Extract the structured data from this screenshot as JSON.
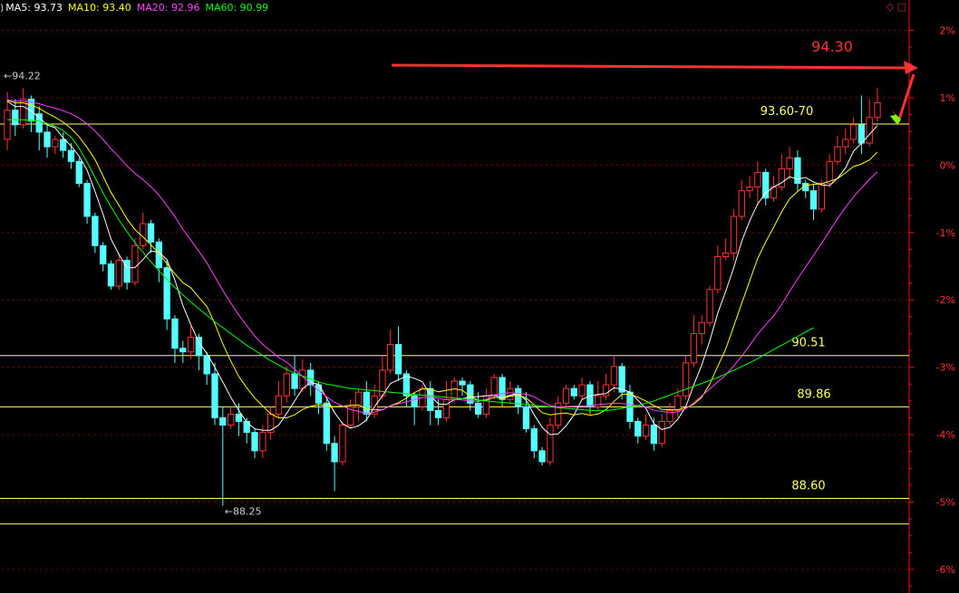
{
  "chart_data": {
    "type": "candlestick",
    "legend": {
      "prefix": ")",
      "items": [
        {
          "label": "MA5: 93.73",
          "color": "#ffffff"
        },
        {
          "label": "MA10: 93.40",
          "color": "#ffff00"
        },
        {
          "label": "MA20: 92.96",
          "color": "#ff40ff"
        },
        {
          "label": "MA60: 90.99",
          "color": "#00ff00"
        }
      ]
    },
    "corner_icons": "◇ □",
    "y_axis": {
      "side": "right",
      "unit": "percent",
      "ticks": [
        2,
        1,
        0,
        -1,
        -2,
        -3,
        -4,
        -5,
        -6
      ],
      "tick_labels": [
        "2%",
        "1%",
        "0%",
        "-1%",
        "-2%",
        "-3%",
        "-4%",
        "-5%",
        "-6%"
      ],
      "reference_price": 92.0,
      "range": [
        -6.35,
        2.45
      ],
      "grid": "dotted-red"
    },
    "colors": {
      "up": "#ff3232",
      "down": "#54ffff",
      "axis": "#ff0000",
      "ma5": "#ffffff",
      "ma10": "#ffff00",
      "ma20": "#ff40ff",
      "ma60": "#00ff00",
      "hline": "#ffff60",
      "annotation_red": "#ff3232"
    },
    "horizontal_levels": [
      {
        "price": 92.56,
        "label": "93.60-70"
      },
      {
        "price": 89.4,
        "label": "90.51"
      },
      {
        "price": 88.7,
        "label": "89.86"
      },
      {
        "price": 87.45,
        "label": "88.60"
      },
      {
        "price": 87.1,
        "label": ""
      }
    ],
    "annotations": {
      "target_label": "94.30",
      "high_label": "94.22",
      "low_label": "88.25"
    },
    "candles": [
      [
        92.35,
        92.75,
        93.0,
        92.2
      ],
      [
        92.75,
        92.55,
        92.9,
        92.4
      ],
      [
        92.55,
        92.9,
        93.05,
        92.5
      ],
      [
        92.9,
        92.6,
        92.95,
        92.45
      ],
      [
        92.7,
        92.45,
        92.8,
        92.2
      ],
      [
        92.45,
        92.25,
        92.55,
        92.1
      ],
      [
        92.25,
        92.35,
        92.4,
        92.15
      ],
      [
        92.35,
        92.2,
        92.45,
        92.1
      ],
      [
        92.2,
        92.05,
        92.3,
        91.95
      ],
      [
        92.05,
        91.75,
        92.1,
        91.7
      ],
      [
        91.75,
        91.3,
        91.8,
        91.2
      ],
      [
        91.3,
        90.9,
        91.35,
        90.8
      ],
      [
        90.9,
        90.65,
        90.95,
        90.55
      ],
      [
        90.65,
        90.35,
        90.7,
        90.3
      ],
      [
        90.35,
        90.7,
        90.8,
        90.3
      ],
      [
        90.7,
        90.4,
        90.75,
        90.3
      ],
      [
        90.4,
        90.9,
        91.0,
        90.35
      ],
      [
        90.9,
        91.2,
        91.35,
        90.85
      ],
      [
        91.2,
        90.95,
        91.25,
        90.8
      ],
      [
        90.95,
        90.6,
        91.0,
        90.4
      ],
      [
        90.6,
        89.9,
        90.7,
        89.75
      ],
      [
        89.9,
        89.5,
        89.95,
        89.3
      ],
      [
        89.5,
        89.45,
        89.6,
        89.3
      ],
      [
        89.45,
        89.65,
        89.8,
        89.35
      ],
      [
        89.65,
        89.4,
        89.7,
        89.2
      ],
      [
        89.4,
        89.15,
        89.45,
        89.0
      ],
      [
        89.15,
        88.55,
        89.3,
        88.45
      ],
      [
        88.55,
        88.45,
        88.7,
        87.35
      ],
      [
        88.45,
        88.6,
        88.7,
        88.4
      ],
      [
        88.6,
        88.5,
        88.75,
        88.3
      ],
      [
        88.5,
        88.35,
        88.55,
        88.2
      ],
      [
        88.35,
        88.1,
        88.4,
        88.0
      ],
      [
        88.1,
        88.35,
        88.45,
        88.0
      ],
      [
        88.35,
        88.6,
        88.7,
        88.25
      ],
      [
        88.6,
        88.85,
        89.05,
        88.55
      ],
      [
        88.85,
        89.15,
        89.25,
        88.75
      ],
      [
        89.15,
        88.95,
        89.4,
        88.85
      ],
      [
        88.95,
        89.2,
        89.35,
        88.9
      ],
      [
        89.2,
        89.0,
        89.3,
        88.85
      ],
      [
        89.0,
        88.75,
        89.05,
        88.6
      ],
      [
        88.75,
        88.2,
        88.8,
        88.1
      ],
      [
        88.2,
        87.95,
        88.3,
        87.55
      ],
      [
        87.95,
        88.45,
        88.5,
        87.9
      ],
      [
        88.45,
        88.7,
        88.8,
        88.4
      ],
      [
        88.7,
        88.9,
        88.95,
        88.5
      ],
      [
        88.9,
        88.6,
        89.05,
        88.5
      ],
      [
        88.6,
        88.85,
        89.0,
        88.55
      ],
      [
        88.85,
        89.2,
        89.4,
        88.8
      ],
      [
        89.2,
        89.55,
        89.75,
        89.15
      ],
      [
        89.55,
        89.15,
        89.8,
        89.05
      ],
      [
        89.15,
        88.85,
        89.2,
        88.7
      ],
      [
        88.85,
        88.7,
        88.9,
        88.45
      ],
      [
        88.7,
        88.95,
        89.0,
        88.65
      ],
      [
        88.95,
        88.65,
        89.05,
        88.45
      ],
      [
        88.65,
        88.55,
        88.8,
        88.45
      ],
      [
        88.55,
        88.8,
        89.05,
        88.5
      ],
      [
        88.8,
        89.05,
        89.1,
        88.75
      ],
      [
        89.05,
        89.0,
        89.1,
        88.85
      ],
      [
        89.0,
        88.75,
        89.05,
        88.65
      ],
      [
        88.75,
        88.6,
        88.9,
        88.55
      ],
      [
        88.6,
        88.85,
        88.95,
        88.55
      ],
      [
        88.85,
        89.1,
        89.15,
        88.8
      ],
      [
        89.1,
        88.8,
        89.15,
        88.7
      ],
      [
        88.8,
        88.95,
        89.05,
        88.75
      ],
      [
        88.95,
        88.7,
        89.0,
        88.6
      ],
      [
        88.7,
        88.4,
        88.9,
        88.35
      ],
      [
        88.4,
        88.1,
        88.45,
        88.0
      ],
      [
        88.1,
        87.95,
        88.15,
        87.9
      ],
      [
        87.95,
        88.45,
        88.55,
        87.9
      ],
      [
        88.45,
        88.75,
        88.85,
        88.4
      ],
      [
        88.75,
        88.95,
        89.0,
        88.7
      ],
      [
        88.95,
        88.85,
        89.0,
        88.8
      ],
      [
        88.85,
        89.0,
        89.1,
        88.8
      ],
      [
        89.0,
        88.7,
        89.05,
        88.6
      ],
      [
        88.7,
        88.85,
        89.05,
        88.65
      ],
      [
        88.85,
        89.0,
        89.15,
        88.8
      ],
      [
        89.0,
        89.25,
        89.4,
        88.9
      ],
      [
        89.25,
        88.9,
        89.3,
        88.8
      ],
      [
        88.9,
        88.5,
        89.0,
        88.4
      ],
      [
        88.5,
        88.3,
        88.55,
        88.2
      ],
      [
        88.3,
        88.45,
        88.6,
        88.25
      ],
      [
        88.45,
        88.2,
        88.55,
        88.1
      ],
      [
        88.2,
        88.5,
        88.6,
        88.15
      ],
      [
        88.5,
        88.65,
        88.75,
        88.45
      ],
      [
        88.65,
        88.85,
        88.95,
        88.55
      ],
      [
        88.85,
        89.3,
        89.4,
        88.8
      ],
      [
        89.3,
        89.7,
        89.95,
        89.25
      ],
      [
        89.7,
        89.85,
        89.95,
        89.55
      ],
      [
        89.85,
        90.3,
        90.35,
        89.8
      ],
      [
        90.3,
        90.75,
        90.9,
        90.25
      ],
      [
        90.75,
        90.8,
        91.0,
        90.7
      ],
      [
        90.8,
        91.3,
        91.4,
        90.7
      ],
      [
        91.3,
        91.65,
        91.8,
        91.25
      ],
      [
        91.65,
        91.7,
        91.85,
        91.55
      ],
      [
        91.7,
        91.9,
        92.05,
        91.45
      ],
      [
        91.9,
        91.55,
        91.95,
        91.45
      ],
      [
        91.55,
        91.7,
        91.85,
        91.5
      ],
      [
        91.7,
        91.95,
        92.15,
        91.65
      ],
      [
        91.95,
        92.1,
        92.25,
        91.8
      ],
      [
        92.1,
        91.75,
        92.2,
        91.65
      ],
      [
        91.75,
        91.65,
        91.8,
        91.55
      ],
      [
        91.65,
        91.4,
        91.75,
        91.25
      ],
      [
        91.4,
        91.75,
        91.8,
        91.35
      ],
      [
        91.75,
        92.05,
        92.15,
        91.7
      ],
      [
        92.05,
        92.25,
        92.4,
        92.0
      ],
      [
        92.25,
        92.35,
        92.5,
        92.15
      ],
      [
        92.35,
        92.55,
        92.65,
        92.3
      ],
      [
        92.55,
        92.3,
        92.95,
        92.15
      ],
      [
        92.3,
        92.65,
        92.9,
        92.25
      ],
      [
        92.65,
        92.85,
        93.05,
        92.6
      ]
    ],
    "moving_averages": {
      "ma60": [
        92.62,
        92.62,
        92.62,
        92.61,
        92.6,
        92.57,
        92.53,
        92.47,
        92.38,
        92.23,
        92.04,
        91.83,
        91.62,
        91.43,
        91.25,
        91.09,
        90.94,
        90.81,
        90.68,
        90.56,
        90.44,
        90.33,
        90.23,
        90.13,
        90.04,
        89.95,
        89.86,
        89.78,
        89.7,
        89.62,
        89.54,
        89.47,
        89.4,
        89.33,
        89.27,
        89.21,
        89.16,
        89.12,
        89.08,
        89.04,
        89.01,
        88.99,
        88.97,
        88.95,
        88.94,
        88.93,
        88.92,
        88.91,
        88.9,
        88.89,
        88.88,
        88.87,
        88.86,
        88.85,
        88.84,
        88.83,
        88.82,
        88.81,
        88.8,
        88.79,
        88.78,
        88.77,
        88.76,
        88.75,
        88.74,
        88.73,
        88.72,
        88.71,
        88.7,
        88.69,
        88.68,
        88.67,
        88.66,
        88.65,
        88.65,
        88.65,
        88.66,
        88.68,
        88.7,
        88.72,
        88.75,
        88.78,
        88.82,
        88.86,
        88.9,
        88.94,
        88.98,
        89.02,
        89.06,
        89.1,
        89.15,
        89.2,
        89.25,
        89.3,
        89.36,
        89.42,
        89.48,
        89.54,
        89.6,
        89.66,
        89.72,
        89.78
      ],
      "ma60_start": 0
    }
  }
}
